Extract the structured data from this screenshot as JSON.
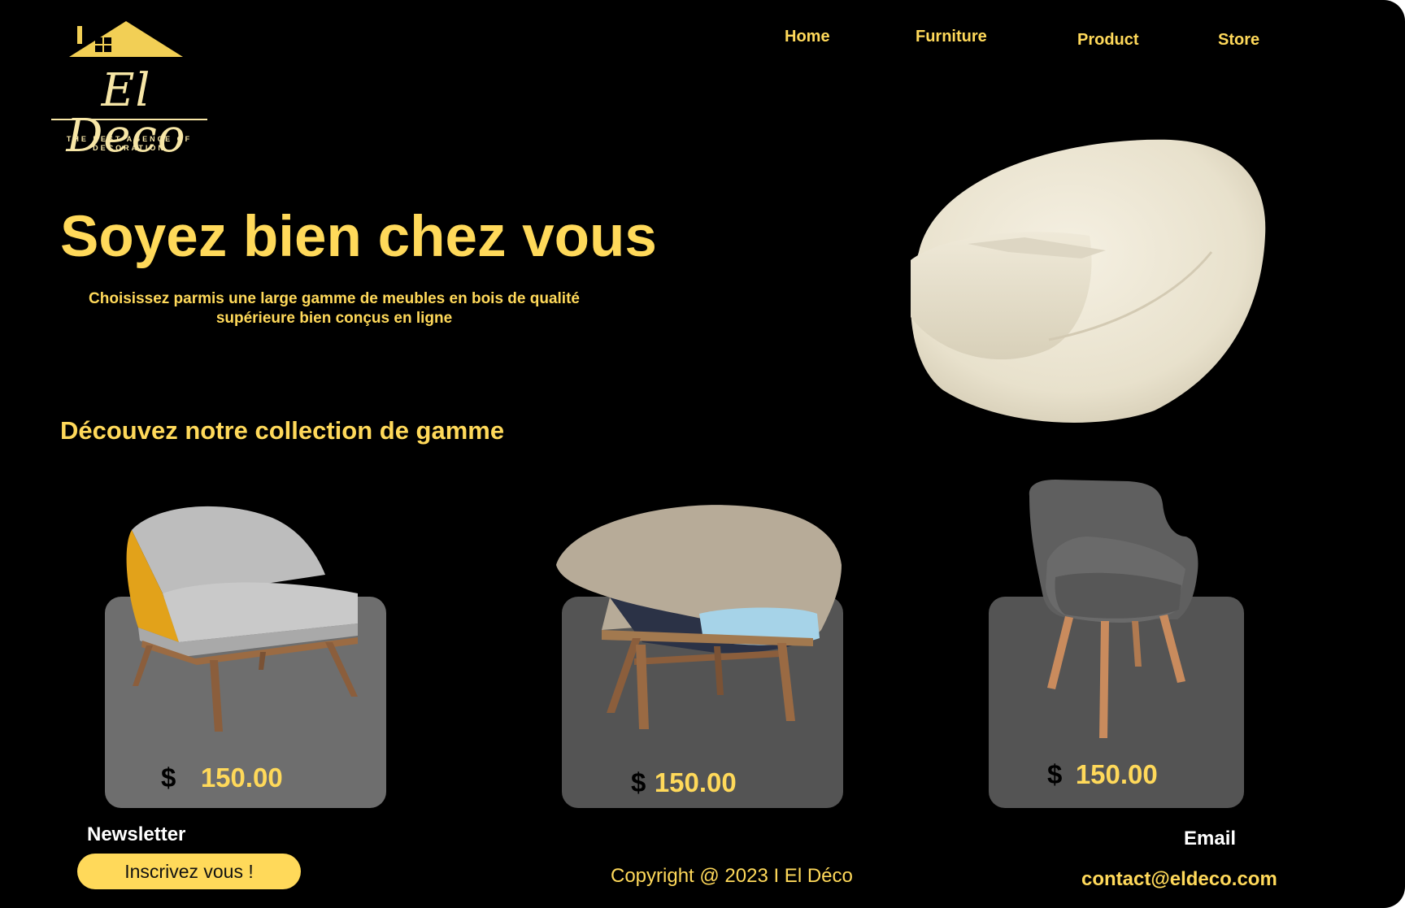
{
  "brand": {
    "name": "El Deco",
    "tagline": "THE BEST AGENCE OF DECORATION"
  },
  "nav": {
    "items": [
      {
        "label": "Home"
      },
      {
        "label": "Furniture"
      },
      {
        "label": "Product"
      },
      {
        "label": "Store"
      }
    ]
  },
  "hero": {
    "title": "Soyez bien chez vous",
    "subtitle": "Choisissez parmis une large gamme de meubles en bois de qualité supérieure bien conçus en ligne"
  },
  "collection": {
    "title": "Découvez notre collection de gamme",
    "products": [
      {
        "currency": "$",
        "price": "150.00"
      },
      {
        "currency": "$",
        "price": "150.00"
      },
      {
        "currency": "$",
        "price": "150.00"
      }
    ]
  },
  "footer": {
    "newsletter_label": "Newsletter",
    "newsletter_button": "Inscrivez vous !",
    "copyright": "Copyright @  2023 I El Déco",
    "email_label": "Email",
    "email": "contact@eldeco.com"
  },
  "colors": {
    "background": "#000000",
    "accent": "#ffd95a",
    "card_light": "#6e6e6e",
    "card_dark": "#545454",
    "text_white": "#ffffff"
  },
  "icons": [
    "house-logo-icon"
  ]
}
